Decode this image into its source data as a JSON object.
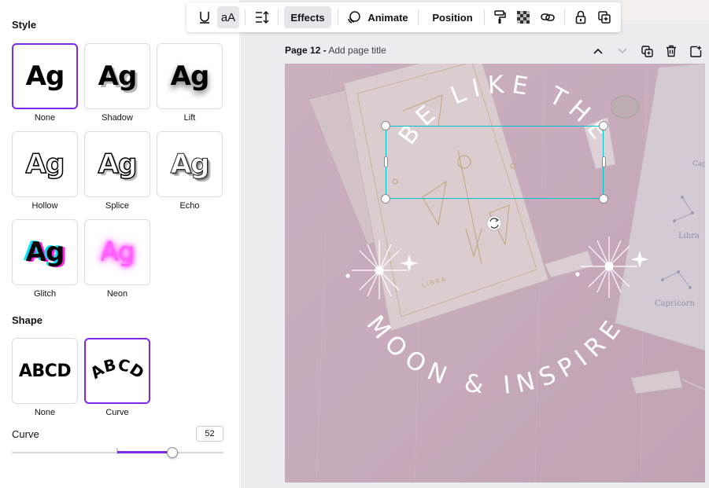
{
  "panel": {
    "style_title": "Style",
    "styles": [
      {
        "label": "None",
        "sample": "Ag",
        "selected": true
      },
      {
        "label": "Shadow",
        "sample": "Ag",
        "selected": false
      },
      {
        "label": "Lift",
        "sample": "Ag",
        "selected": false
      },
      {
        "label": "Hollow",
        "sample": "Ag",
        "selected": false
      },
      {
        "label": "Splice",
        "sample": "Ag",
        "selected": false
      },
      {
        "label": "Echo",
        "sample": "Ag",
        "selected": false
      },
      {
        "label": "Glitch",
        "sample": "Ag",
        "selected": false
      },
      {
        "label": "Neon",
        "sample": "Ag",
        "selected": false
      }
    ],
    "shape_title": "Shape",
    "shapes": [
      {
        "label": "None",
        "sample": "ABCD",
        "selected": false
      },
      {
        "label": "Curve",
        "sample": "ABCD",
        "selected": true
      }
    ],
    "curve_label": "Curve",
    "curve_value": "52"
  },
  "toolbar": {
    "underline_icon": "underline-icon",
    "case_label": "aA",
    "spacing_icon": "line-spacing-icon",
    "effects_label": "Effects",
    "animate_label": "Animate",
    "position_label": "Position",
    "paint_icon": "paint-roller-icon",
    "transparency_icon": "transparency-icon",
    "link_icon": "link-icon",
    "lock_icon": "lock-icon",
    "copy_style_icon": "duplicate-icon"
  },
  "page": {
    "label": "Page 12 -",
    "title_placeholder": "Add page title"
  },
  "canvas": {
    "arc_top_text": "BE LIKE THE",
    "arc_bottom_text": "MOON & INSPIRE",
    "card_text": "LIBRA",
    "book_text_1": "Libra",
    "book_text_2": "Capricorn",
    "book_text_3": "Cap"
  },
  "colors": {
    "accent": "#7d2ae8",
    "selection": "#00c4cc"
  }
}
